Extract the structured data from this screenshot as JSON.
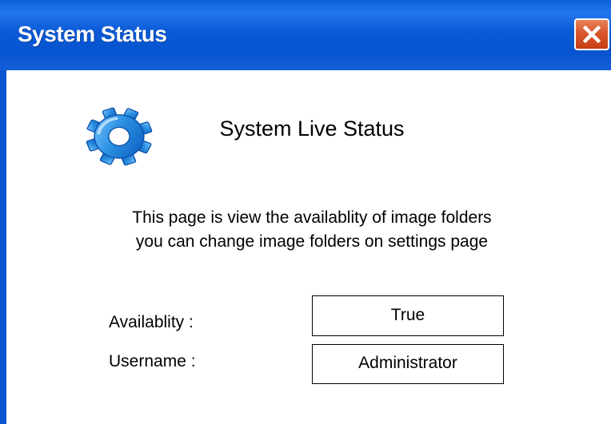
{
  "window": {
    "title": "System Status",
    "close_icon": "close-icon"
  },
  "content": {
    "icon": "gear-icon",
    "heading": "System Live Status",
    "description_line1": "This page is view the availablity of image folders",
    "description_line2": "you can change image folders on settings page",
    "fields": [
      {
        "label": "Availablity :",
        "value": "True"
      },
      {
        "label": "Username :",
        "value": "Administrator"
      }
    ]
  },
  "colors": {
    "titlebar": "#0a5fd8",
    "close_button": "#d9572e",
    "gear": "#2a8fe0"
  }
}
